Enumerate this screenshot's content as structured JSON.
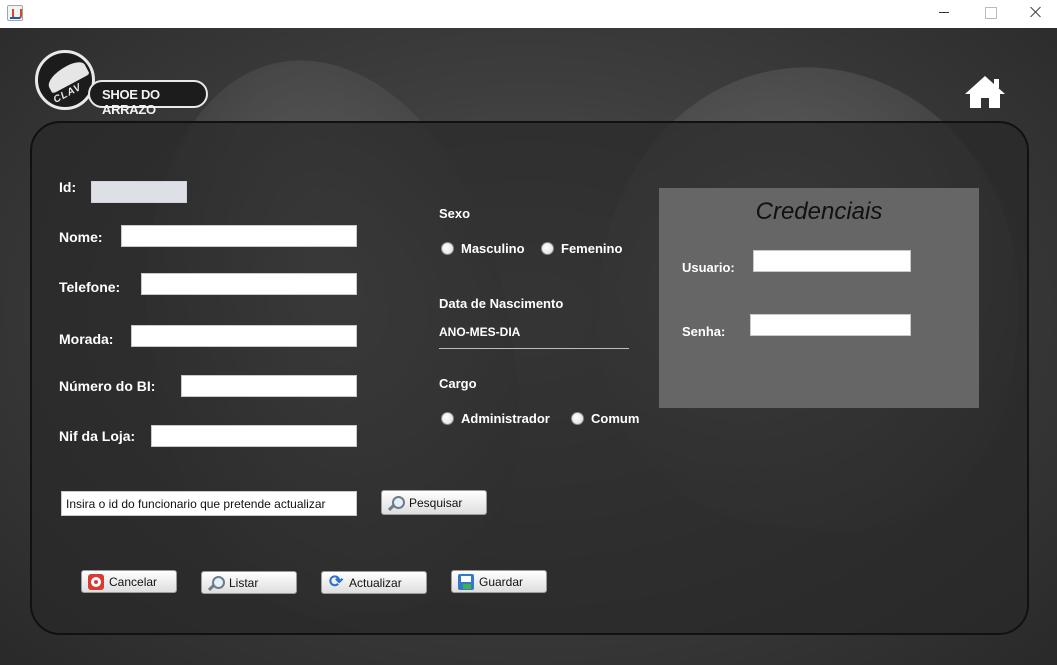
{
  "window": {
    "title": ""
  },
  "logo": {
    "circle_text": "CLAV",
    "brand_text": "SHOE DO ARRAZO"
  },
  "form": {
    "id_label": "Id:",
    "id_value": "",
    "nome_label": "Nome:",
    "telefone_label": "Telefone:",
    "morada_label": "Morada:",
    "bi_label": "Número do BI:",
    "nif_label": "Nif da Loja:",
    "search_value": "Insira o id do funcionario que pretende actualizar",
    "search_button": "Pesquisar"
  },
  "sexo": {
    "label": "Sexo",
    "options": [
      "Masculino",
      "Femenino"
    ]
  },
  "nascimento": {
    "label": "Data de Nascimento",
    "placeholder": "ANO-MES-DIA"
  },
  "cargo": {
    "label": "Cargo",
    "options": [
      "Administrador",
      "Comum"
    ]
  },
  "credenciais": {
    "title": "Credenciais",
    "usuario_label": "Usuario:",
    "senha_label": "Senha:"
  },
  "actions": {
    "cancelar": "Cancelar",
    "listar": "Listar",
    "actualizar": "Actualizar",
    "guardar": "Guardar"
  },
  "icons": {
    "app": "java-icon",
    "home": "home-icon",
    "search": "magnifier-icon",
    "cancel": "cancel-icon",
    "refresh": "refresh-icon",
    "save": "floppy-disk-icon"
  },
  "colors": {
    "panel_bg": "#282828",
    "credenciais_bg": "#666666",
    "text": "#ffffff",
    "disabled_field": "#dde0e6"
  }
}
